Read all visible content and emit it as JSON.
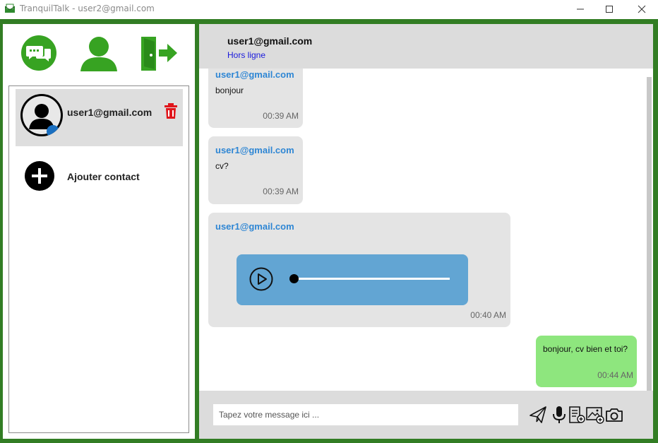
{
  "window": {
    "title": "TranquilTalk - user2@gmail.com",
    "accent": "#327d24"
  },
  "nav": {
    "items": [
      "chat-icon",
      "user-icon",
      "logout-icon"
    ],
    "active": "chat-icon"
  },
  "contacts": [
    {
      "name": "user1@gmail.com",
      "status_color": "#1a6fc0",
      "selected": true
    }
  ],
  "add_contact_label": "Ajouter contact",
  "chat": {
    "header_name": "user1@gmail.com",
    "header_status": "Hors ligne",
    "messages": [
      {
        "sender": "user1@gmail.com",
        "text": "bonjour",
        "time": "00:39 AM"
      },
      {
        "sender": "user1@gmail.com",
        "text": "cv?",
        "time": "00:39 AM"
      },
      {
        "sender": "user1@gmail.com",
        "type": "audio",
        "time": "00:40 AM",
        "audio_progress": 0
      },
      {
        "text": "bonjour, cv bien et toi?",
        "time": "00:44 AM",
        "outgoing": true
      }
    ]
  },
  "composer": {
    "placeholder": "Tapez votre message ici ...",
    "tools": [
      "send-icon",
      "microphone-icon",
      "document-icon",
      "image-icon",
      "camera-icon"
    ]
  }
}
